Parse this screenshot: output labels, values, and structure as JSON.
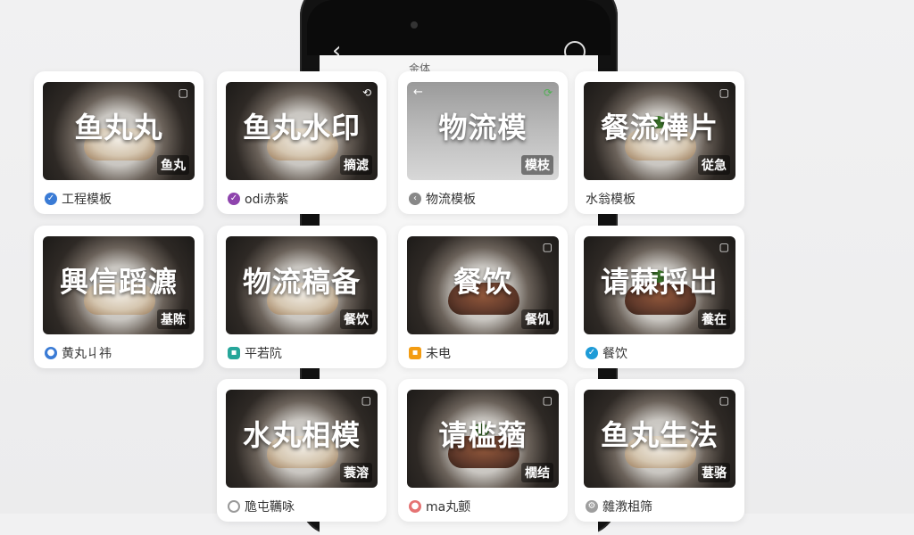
{
  "background_phone": {
    "back_glyph": "‹",
    "screen_text": "金体"
  },
  "cards": [
    {
      "title": "鱼丸丸",
      "tag": "鱼丸",
      "caption": "工程模板",
      "icon": "shield-check-icon",
      "icon_color": "#3a7bd5"
    },
    {
      "title": "鱼丸水印",
      "tag": "摘滤",
      "caption": "odi赤紫",
      "icon": "check-heart-icon",
      "icon_color": "#8e44ad"
    },
    {
      "title": "物流模",
      "tag": "模枝",
      "caption": "物流模板",
      "icon": "arrow-left-icon",
      "icon_color": "#888888"
    },
    {
      "title": "餐流樺片",
      "tag": "従急",
      "caption": "水翁模板",
      "icon": "none",
      "icon_color": "#ffffff"
    },
    {
      "title": "興信蹈瀌",
      "tag": "基陈",
      "caption": "黄丸丩祎",
      "icon": "user-icon",
      "icon_color": "#3a7bd5"
    },
    {
      "title": "物流稿备",
      "tag": "餐饮",
      "caption": "平若阬",
      "icon": "chat-icon",
      "icon_color": "#26a69a"
    },
    {
      "title": "餐饮",
      "tag": "餐饥",
      "caption": "未电",
      "icon": "box-icon",
      "icon_color": "#f39c12"
    },
    {
      "title": "请蕀捋岀",
      "tag": "養在",
      "caption": "餐饮",
      "icon": "check-icon",
      "icon_color": "#1e9bd7"
    },
    {
      "title": "水丸相模",
      "tag": "蓑溶",
      "caption": "卼屯韉咏",
      "icon": "circle-icon",
      "icon_color": "#999999"
    },
    {
      "title": "请槛蕕",
      "tag": "橌结",
      "caption": "ma丸颤",
      "icon": "tag-icon",
      "icon_color": "#e57373"
    },
    {
      "title": "鱼丸生法",
      "tag": "葚骆",
      "caption": "雜漖柤筛",
      "icon": "gear-icon",
      "icon_color": "#9e9e9e"
    }
  ]
}
